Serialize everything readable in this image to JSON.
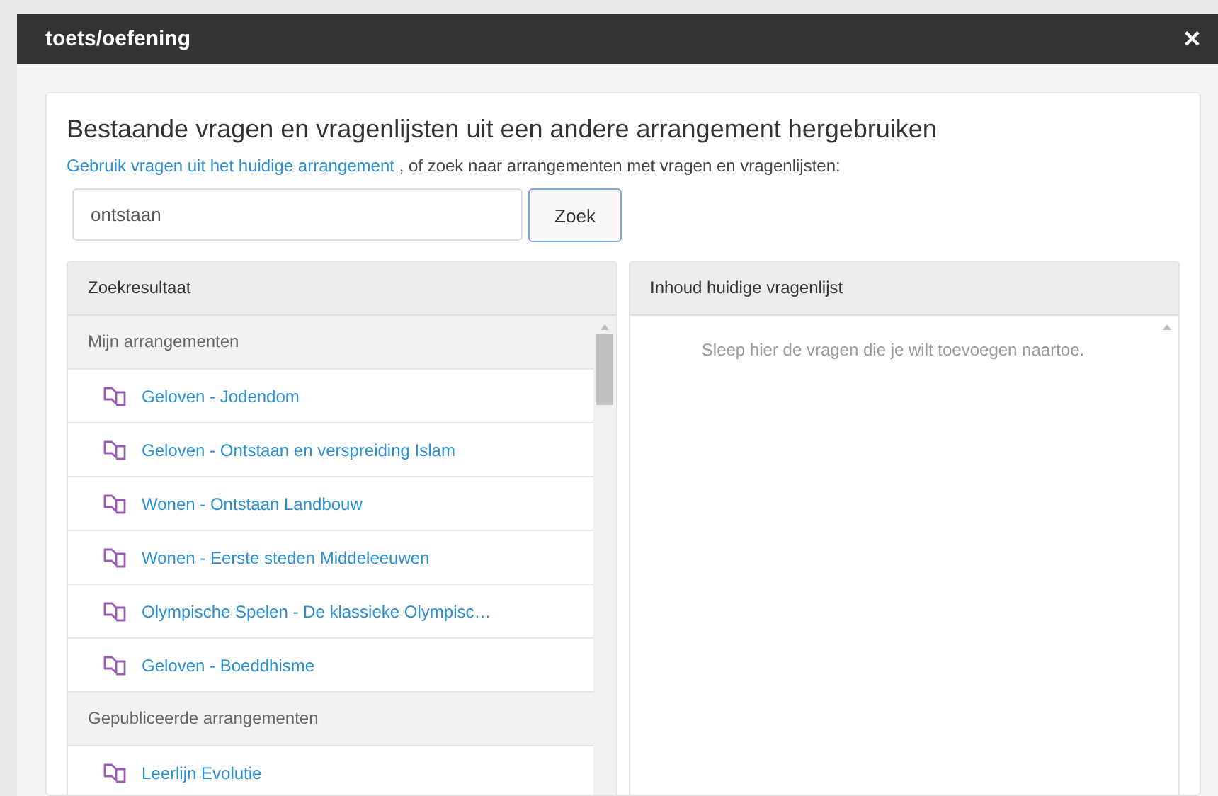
{
  "dialog": {
    "title": "toets/oefening",
    "close": "✕"
  },
  "heading": "Bestaande vragen en vragenlijsten uit een andere arrangement hergebruiken",
  "intro": {
    "link": "Gebruik vragen uit het huidige arrangement",
    "text": ", of zoek naar arrangementen met vragen en vragenlijsten:"
  },
  "search": {
    "value": "ontstaan",
    "button": "Zoek"
  },
  "results": {
    "title": "Zoekresultaat",
    "groups": [
      {
        "label": "Mijn arrangementen",
        "items": [
          "Geloven - Jodendom",
          "Geloven - Ontstaan en verspreiding Islam",
          "Wonen - Ontstaan Landbouw",
          "Wonen - Eerste steden Middeleeuwen",
          "Olympische Spelen - De klassieke Olympisc…",
          "Geloven - Boeddhisme"
        ]
      },
      {
        "label": "Gepubliceerde arrangementen",
        "items": [
          "Leerlijn Evolutie"
        ]
      }
    ]
  },
  "current": {
    "title": "Inhoud huidige vragenlijst",
    "empty": "Sleep hier de vragen die je wilt toevoegen naartoe."
  }
}
